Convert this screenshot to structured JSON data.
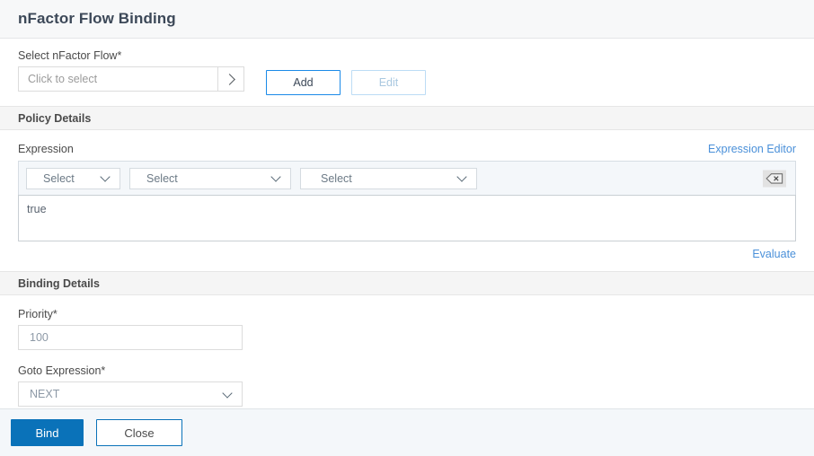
{
  "dialog": {
    "title": "nFactor Flow Binding"
  },
  "flow_selection": {
    "label": "Select nFactor Flow*",
    "placeholder": "Click to select",
    "value": "",
    "expand_icon": "chevron-right-icon",
    "add_label": "Add",
    "edit_label": "Edit",
    "edit_disabled": true
  },
  "policy_details": {
    "section_title": "Policy Details",
    "expression_label": "Expression",
    "expression_editor_link": "Expression Editor",
    "builder": {
      "select1": "Select",
      "select2": "Select",
      "select3": "Select",
      "dropdown_icon": "chevron-down-icon",
      "erase_icon": "backspace-icon"
    },
    "expression_value": "true",
    "expression_placeholder": "",
    "evaluate_link": "Evaluate"
  },
  "binding_details": {
    "section_title": "Binding Details",
    "priority_label": "Priority*",
    "priority_value": "100",
    "goto_label": "Goto Expression*",
    "goto_value": "NEXT",
    "goto_icon": "chevron-down-icon"
  },
  "footer": {
    "bind_label": "Bind",
    "close_label": "Close"
  },
  "colors": {
    "primary": "#0a72b9",
    "link": "#4a90d9",
    "accent_border": "#1b8ae8",
    "title_text": "#3c4858",
    "band_bg": "#f5f5f5",
    "footer_bg": "#f4f7fa",
    "builder_bg": "#f4f7fa"
  }
}
